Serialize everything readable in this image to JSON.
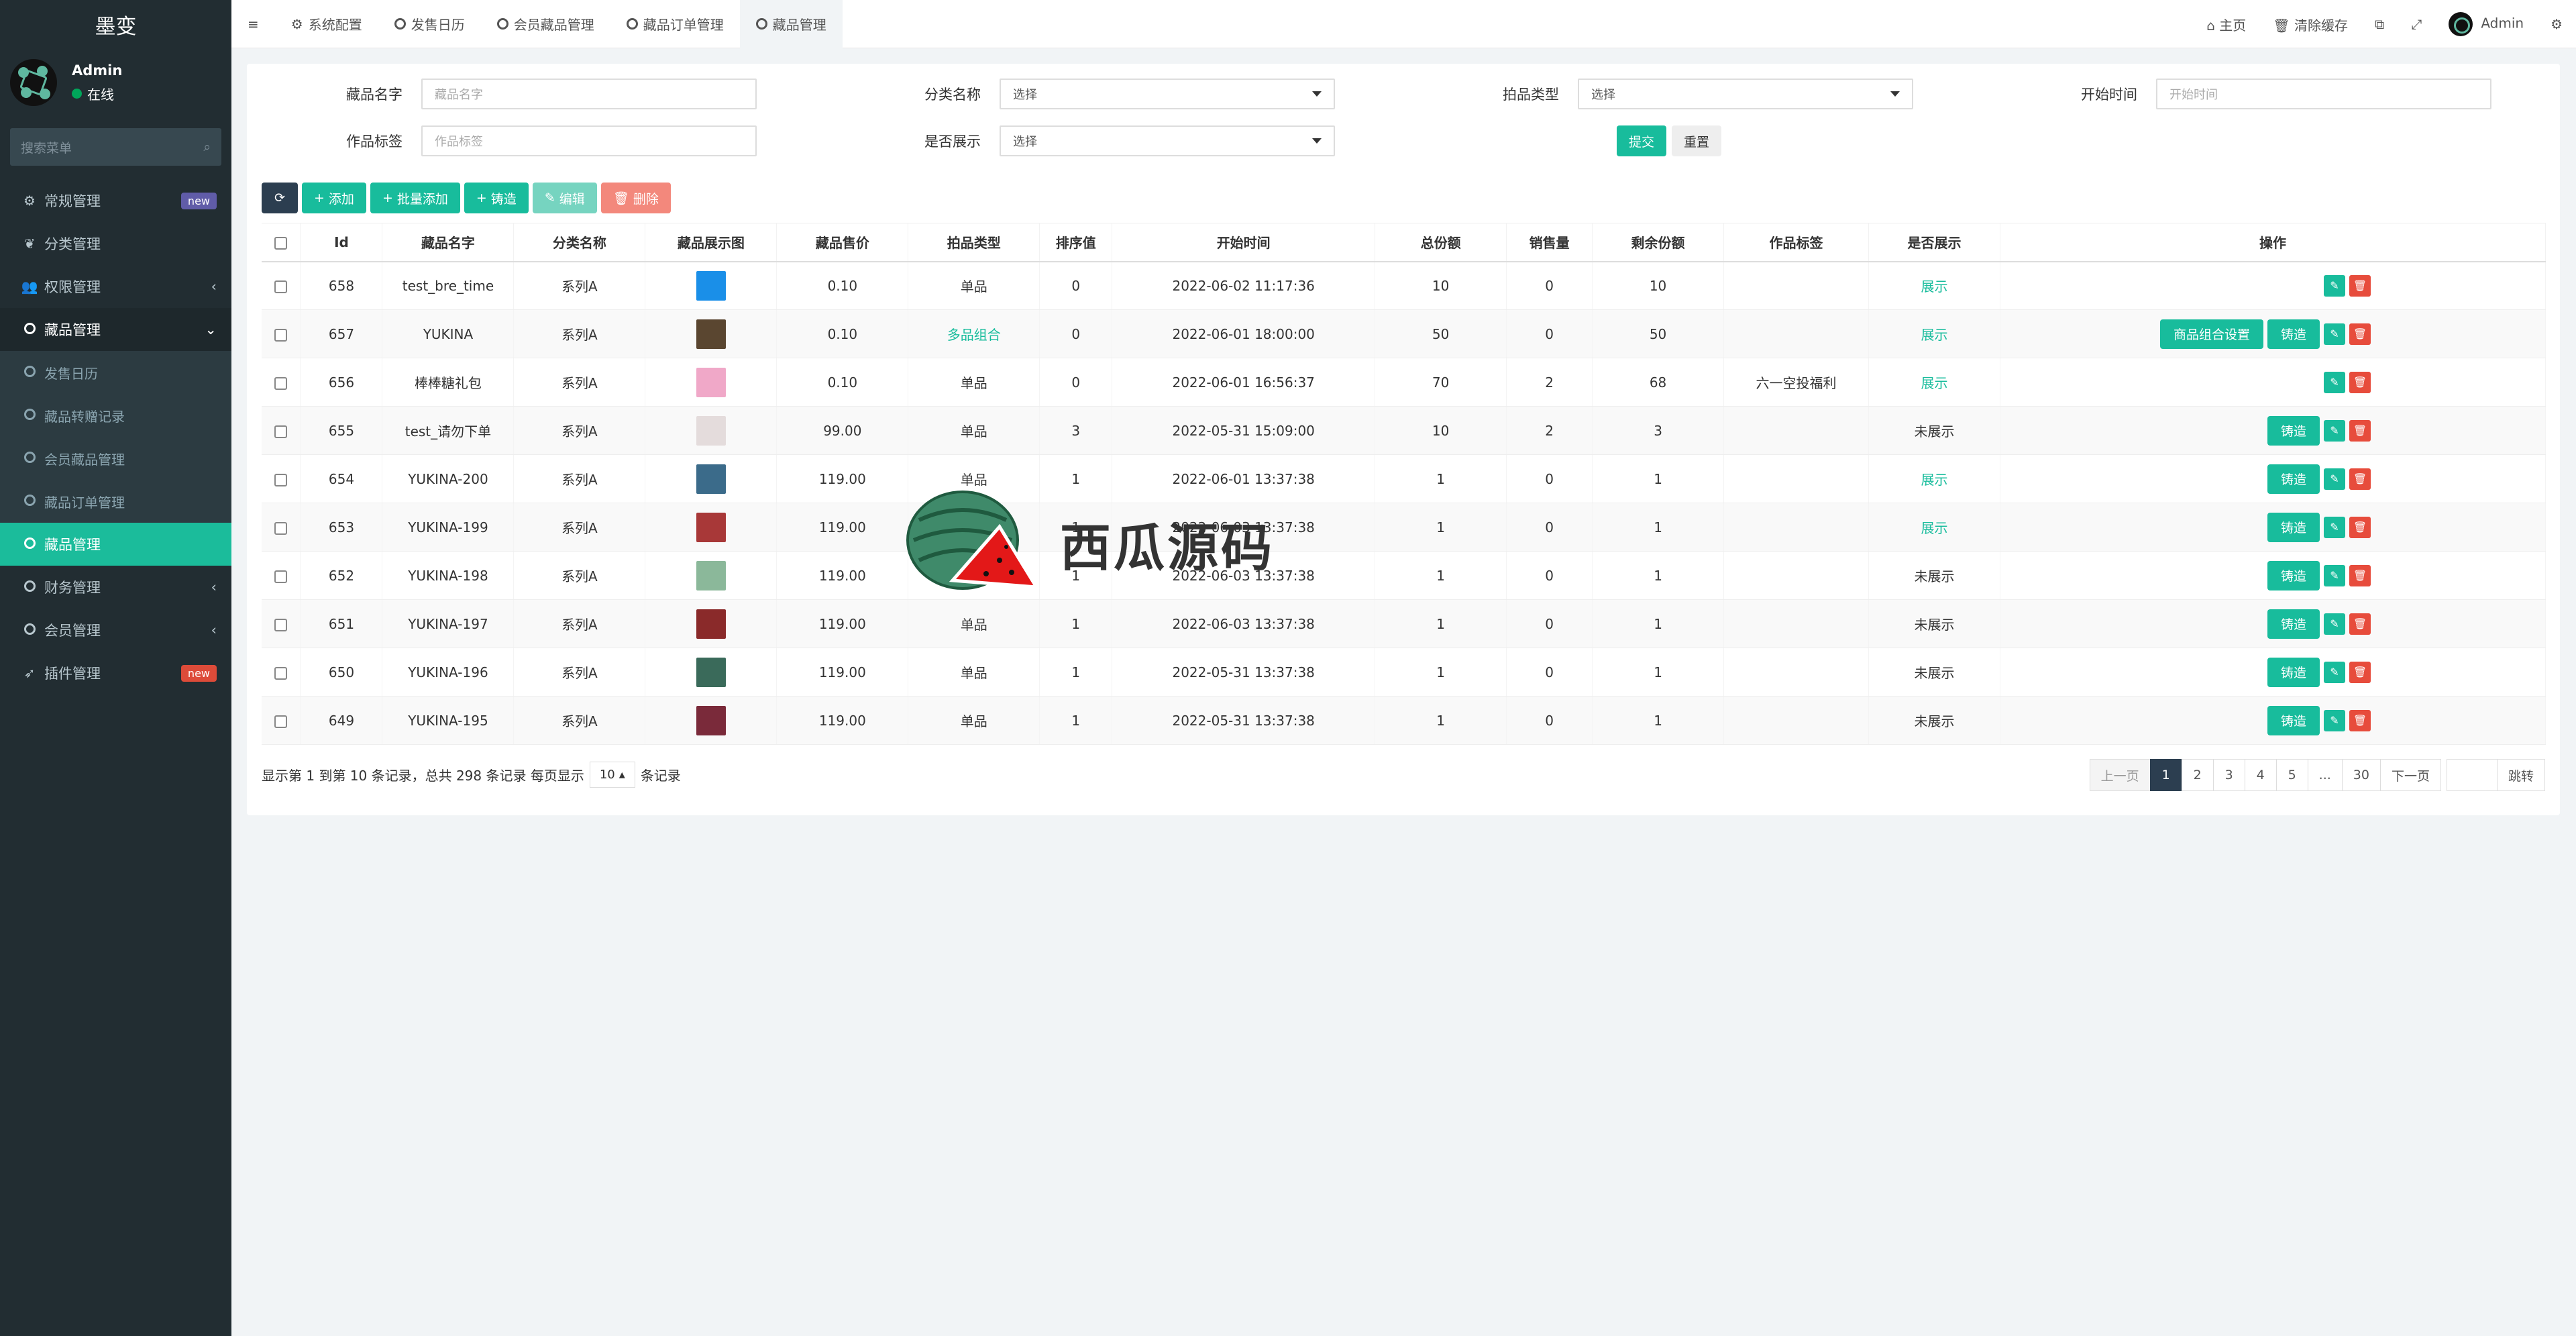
{
  "sidebar": {
    "logo": "墨变",
    "user_name": "Admin",
    "user_status": "在线",
    "search_placeholder": "搜索菜单",
    "items": [
      {
        "label": "常规管理",
        "badge": "new"
      },
      {
        "label": "分类管理"
      },
      {
        "label": "权限管理"
      },
      {
        "label": "藏品管理"
      },
      {
        "label": "发售日历"
      },
      {
        "label": "藏品转赠记录"
      },
      {
        "label": "会员藏品管理"
      },
      {
        "label": "藏品订单管理"
      },
      {
        "label": "藏品管理"
      },
      {
        "label": "财务管理"
      },
      {
        "label": "会员管理"
      },
      {
        "label": "插件管理",
        "badge": "new"
      }
    ]
  },
  "topbar": {
    "tabs": [
      "系统配置",
      "发售日历",
      "会员藏品管理",
      "藏品订单管理",
      "藏品管理"
    ],
    "home": "主页",
    "clear_cache": "清除缓存",
    "user": "Admin"
  },
  "filters": {
    "name_label": "藏品名字",
    "name_placeholder": "藏品名字",
    "cat_label": "分类名称",
    "cat_value": "选择",
    "type_label": "拍品类型",
    "type_value": "选择",
    "start_label": "开始时间",
    "start_placeholder": "开始时间",
    "tag_label": "作品标签",
    "tag_placeholder": "作品标签",
    "show_label": "是否展示",
    "show_value": "选择",
    "submit": "提交",
    "reset": "重置"
  },
  "toolbar": {
    "add": "添加",
    "batch_add": "批量添加",
    "cast": "铸造",
    "edit": "编辑",
    "delete": "删除"
  },
  "table": {
    "headers": [
      "Id",
      "藏品名字",
      "分类名称",
      "藏品展示图",
      "藏品售价",
      "拍品类型",
      "排序值",
      "开始时间",
      "总份额",
      "销售量",
      "剩余份额",
      "作品标签",
      "是否展示",
      "操作"
    ],
    "rows": [
      {
        "id": "658",
        "name": "test_bre_time",
        "cat": "系列A",
        "img": "#1a8fe8",
        "price": "0.10",
        "type": "单品",
        "sort": "0",
        "start": "2022-06-02 11:17:36",
        "total": "10",
        "sold": "0",
        "left": "10",
        "tag": "",
        "show": "展示",
        "ops": []
      },
      {
        "id": "657",
        "name": "YUKINA",
        "cat": "系列A",
        "img": "#5a4630",
        "price": "0.10",
        "type": "多品组合",
        "sort": "0",
        "start": "2022-06-01 18:00:00",
        "total": "50",
        "sold": "0",
        "left": "50",
        "tag": "",
        "show": "展示",
        "ops": [
          "商品组合设置",
          "铸造"
        ]
      },
      {
        "id": "656",
        "name": "棒棒糖礼包",
        "cat": "系列A",
        "img": "#f0a8c8",
        "price": "0.10",
        "type": "单品",
        "sort": "0",
        "start": "2022-06-01 16:56:37",
        "total": "70",
        "sold": "2",
        "left": "68",
        "tag": "六一空投福利",
        "show": "展示",
        "ops": []
      },
      {
        "id": "655",
        "name": "test_请勿下单",
        "cat": "系列A",
        "img": "#e4dcdc",
        "price": "99.00",
        "type": "单品",
        "sort": "3",
        "start": "2022-05-31 15:09:00",
        "total": "10",
        "sold": "2",
        "left": "3",
        "tag": "",
        "show": "未展示",
        "ops": [
          "铸造"
        ]
      },
      {
        "id": "654",
        "name": "YUKINA-200",
        "cat": "系列A",
        "img": "#3b6b8a",
        "price": "119.00",
        "type": "单品",
        "sort": "1",
        "start": "2022-06-01 13:37:38",
        "total": "1",
        "sold": "0",
        "left": "1",
        "tag": "",
        "show": "展示",
        "ops": [
          "铸造"
        ]
      },
      {
        "id": "653",
        "name": "YUKINA-199",
        "cat": "系列A",
        "img": "#a83838",
        "price": "119.00",
        "type": "单品",
        "sort": "1",
        "start": "2022-06-03 13:37:38",
        "total": "1",
        "sold": "0",
        "left": "1",
        "tag": "",
        "show": "展示",
        "ops": [
          "铸造"
        ]
      },
      {
        "id": "652",
        "name": "YUKINA-198",
        "cat": "系列A",
        "img": "#8bb89a",
        "price": "119.00",
        "type": "单品",
        "sort": "1",
        "start": "2022-06-03 13:37:38",
        "total": "1",
        "sold": "0",
        "left": "1",
        "tag": "",
        "show": "未展示",
        "ops": [
          "铸造"
        ]
      },
      {
        "id": "651",
        "name": "YUKINA-197",
        "cat": "系列A",
        "img": "#8a2a2a",
        "price": "119.00",
        "type": "单品",
        "sort": "1",
        "start": "2022-06-03 13:37:38",
        "total": "1",
        "sold": "0",
        "left": "1",
        "tag": "",
        "show": "未展示",
        "ops": [
          "铸造"
        ]
      },
      {
        "id": "650",
        "name": "YUKINA-196",
        "cat": "系列A",
        "img": "#3a6a5a",
        "price": "119.00",
        "type": "单品",
        "sort": "1",
        "start": "2022-05-31 13:37:38",
        "total": "1",
        "sold": "0",
        "left": "1",
        "tag": "",
        "show": "未展示",
        "ops": [
          "铸造"
        ]
      },
      {
        "id": "649",
        "name": "YUKINA-195",
        "cat": "系列A",
        "img": "#7a2a3a",
        "price": "119.00",
        "type": "单品",
        "sort": "1",
        "start": "2022-05-31 13:37:38",
        "total": "1",
        "sold": "0",
        "left": "1",
        "tag": "",
        "show": "未展示",
        "ops": [
          "铸造"
        ]
      }
    ]
  },
  "pagination": {
    "info_prefix": "显示第 1 到第 10 条记录，总共 298 条记录 每页显示",
    "page_size": "10",
    "info_suffix": "条记录",
    "prev": "上一页",
    "pages": [
      "1",
      "2",
      "3",
      "4",
      "5",
      "...",
      "30"
    ],
    "next": "下一页",
    "jump": "跳转"
  },
  "watermark": "西瓜源码",
  "colors": {
    "accent": "#18bc9c",
    "sidebar": "#222d32",
    "danger": "#e74c3c",
    "dark": "#2c3e50"
  }
}
